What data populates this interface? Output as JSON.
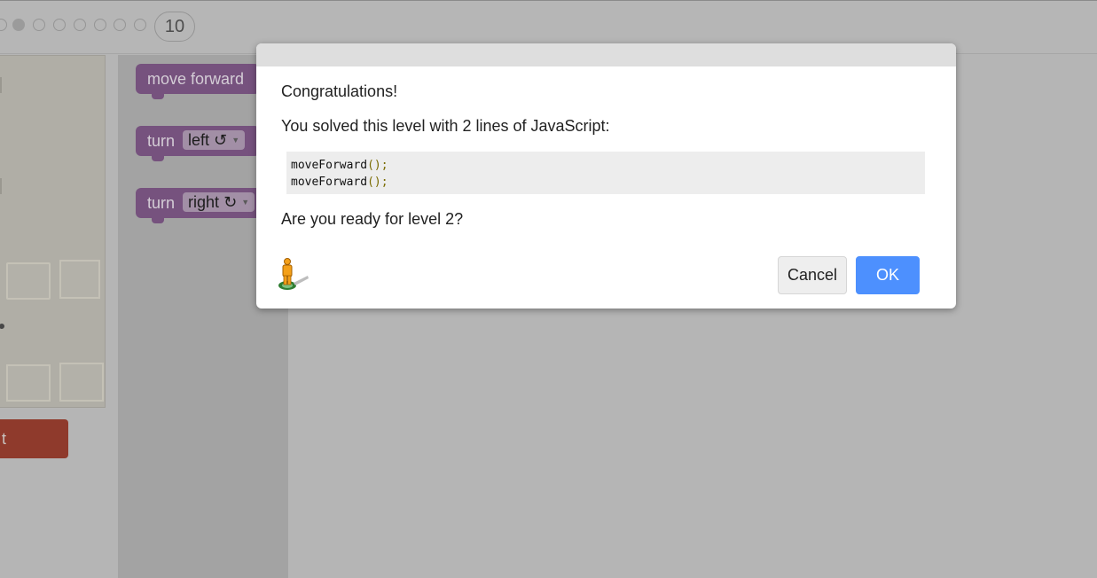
{
  "level_bar": {
    "current_level": "10"
  },
  "run_button": {
    "label": "t"
  },
  "toolbox": {
    "blocks": [
      {
        "label": "move forward"
      },
      {
        "label": "turn",
        "option": "left ↺"
      },
      {
        "label": "turn",
        "option": "right ↻"
      }
    ]
  },
  "dialog": {
    "heading": "Congratulations!",
    "message": "You solved this level with 2 lines of JavaScript:",
    "code_lines": [
      {
        "call": "moveForward",
        "punct": "();"
      },
      {
        "call": "moveForward",
        "punct": "();"
      }
    ],
    "question": "Are you ready for level 2?",
    "cancel_label": "Cancel",
    "ok_label": "OK"
  },
  "colors": {
    "ok_button": "#4d90fe",
    "block_purple": "#76527e",
    "run_button": "#8f3a2c"
  },
  "icons": {
    "pegman": "pegman-icon"
  }
}
